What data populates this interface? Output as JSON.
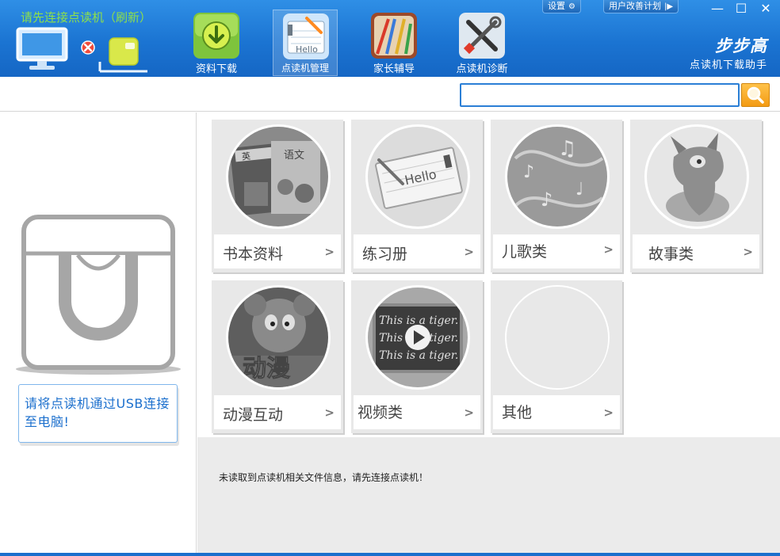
{
  "header": {
    "status_text": "请先连接点读机（刷新）",
    "nav_tabs": [
      {
        "label": "资料下载",
        "icon": "download-icon",
        "active": false
      },
      {
        "label": "点读机管理",
        "icon": "hello-notebook-icon",
        "active": true
      },
      {
        "label": "家长辅导",
        "icon": "art-supplies-icon",
        "active": false
      },
      {
        "label": "点读机诊断",
        "icon": "tools-icon",
        "active": false
      }
    ],
    "settings_label": "设置",
    "improve_plan_label": "用户改善计划",
    "brand": "步步高",
    "subtitle": "点读机下载助手",
    "window_controls": {
      "minimize": "—",
      "maximize": "☐",
      "close": "✕"
    }
  },
  "search": {
    "value": "",
    "placeholder": "",
    "button_icon": "search-icon"
  },
  "left_panel": {
    "device_icon": "reader-device-icon",
    "hint_text": "请将点读机通过USB连接至电脑!"
  },
  "categories": [
    {
      "label": "书本资料",
      "icon": "textbooks-thumbnail"
    },
    {
      "label": "练习册",
      "icon": "hello-notebook-thumbnail"
    },
    {
      "label": "儿歌类",
      "icon": "music-notes-thumbnail"
    },
    {
      "label": "故事类",
      "icon": "cartoon-horse-thumbnail"
    },
    {
      "label": "动漫互动",
      "icon": "cartoon-animation-thumbnail"
    },
    {
      "label": "视频类",
      "icon": "video-chalkboard-thumbnail"
    },
    {
      "label": "其他",
      "icon": "other-thumbnail"
    }
  ],
  "book_cover_text": [
    "英",
    "语文"
  ],
  "notebook_text": "Hello",
  "chalkboard_text": [
    "This is a tiger.",
    "This is a tiger.",
    "This is a tiger."
  ],
  "cartoon_text": "动漫",
  "info_message": "未读取到点读机相关文件信息，请先连接点读机！",
  "colors": {
    "header_blue": "#1b74d2",
    "status_green": "#8fe04a",
    "hint_blue": "#1b6fcd",
    "search_orange": "#f39b13"
  }
}
